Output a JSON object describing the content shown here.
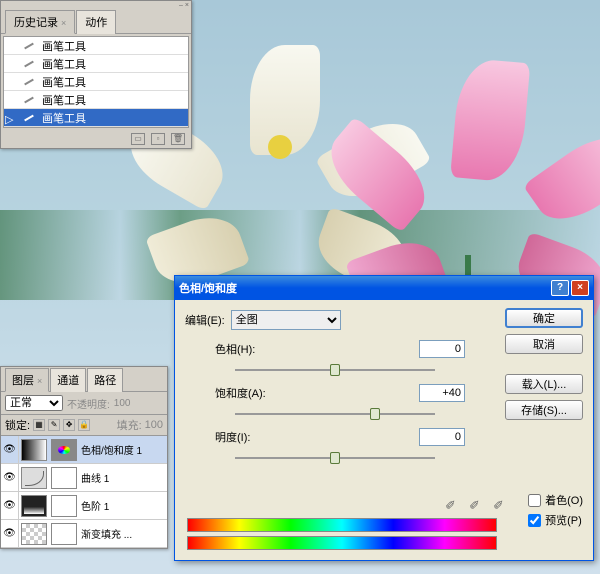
{
  "history": {
    "tab_history": "历史记录",
    "tab_actions": "动作",
    "item_label": "画笔工具",
    "items": [
      "画笔工具",
      "画笔工具",
      "画笔工具",
      "画笔工具",
      "画笔工具"
    ],
    "selected_index": 4
  },
  "layers": {
    "tab_layers": "图层",
    "tab_channels": "通道",
    "tab_paths": "路径",
    "blend_mode": "正常",
    "opacity_label": "不透明度:",
    "opacity_value": "100",
    "lock_label": "锁定:",
    "fill_label": "填充:",
    "fill_value": "100",
    "rows": [
      {
        "name": "色相/饱和度 1"
      },
      {
        "name": "曲线 1"
      },
      {
        "name": "色阶 1"
      },
      {
        "name": "渐变填充 ..."
      }
    ]
  },
  "dialog": {
    "title": "色相/饱和度",
    "edit_label": "编辑(E):",
    "edit_value": "全图",
    "hue_label": "色相(H):",
    "hue_value": "0",
    "sat_label": "饱和度(A):",
    "sat_value": "+40",
    "light_label": "明度(I):",
    "light_value": "0",
    "ok": "确定",
    "cancel": "取消",
    "load": "载入(L)...",
    "save": "存储(S)...",
    "colorize": "着色(O)",
    "preview": "预览(P)",
    "preview_checked": true
  }
}
